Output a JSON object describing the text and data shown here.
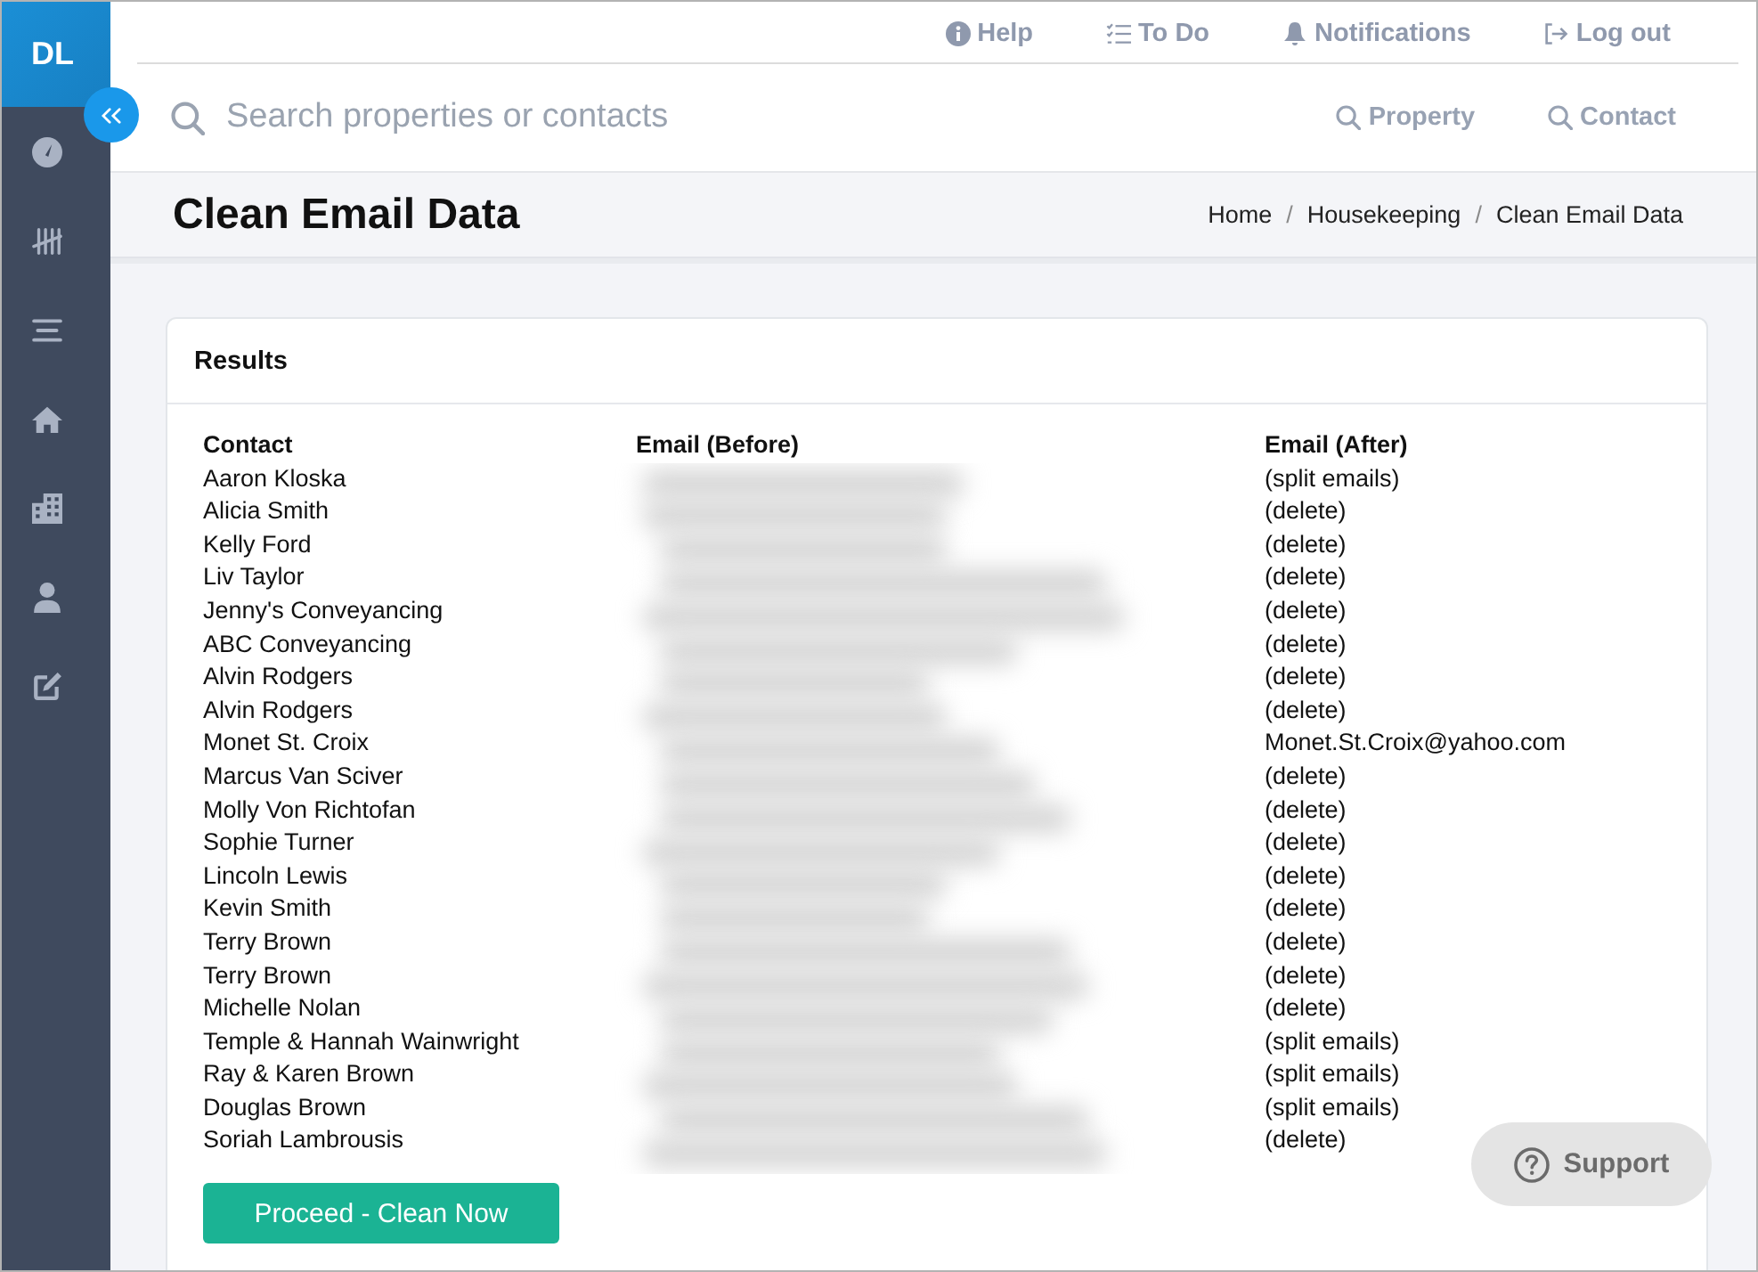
{
  "sidebar": {
    "logo": "DL"
  },
  "top_links": [
    {
      "label": "Help"
    },
    {
      "label": "To Do"
    },
    {
      "label": "Notifications"
    },
    {
      "label": "Log out"
    }
  ],
  "search": {
    "placeholder": "Search properties or contacts",
    "scopes": [
      {
        "label": "Property"
      },
      {
        "label": "Contact"
      }
    ]
  },
  "page_header": {
    "title": "Clean Email Data",
    "breadcrumb": [
      {
        "label": "Home"
      },
      {
        "separator": "/",
        "label": "Housekeeping"
      },
      {
        "separator": "/",
        "label": "Clean Email Data"
      }
    ]
  },
  "card": {
    "title": "Results",
    "table": {
      "columns": [
        "Contact",
        "Email (Before)",
        "Email (After)"
      ],
      "rows": [
        {
          "contact": "Aaron Kloska",
          "email_after": "(split emails)"
        },
        {
          "contact": "Alicia Smith",
          "email_after": "(delete)"
        },
        {
          "contact": "Kelly Ford",
          "email_after": "(delete)"
        },
        {
          "contact": "Liv Taylor",
          "email_after": "(delete)"
        },
        {
          "contact": "Jenny's Conveyancing",
          "email_after": "(delete)"
        },
        {
          "contact": "ABC Conveyancing",
          "email_after": "(delete)"
        },
        {
          "contact": "Alvin Rodgers",
          "email_after": "(delete)"
        },
        {
          "contact": "Alvin Rodgers",
          "email_after": "(delete)"
        },
        {
          "contact": "Monet St. Croix",
          "email_after": "Monet.St.Croix@yahoo.com"
        },
        {
          "contact": "Marcus Van Sciver",
          "email_after": "(delete)"
        },
        {
          "contact": "Molly Von Richtofan",
          "email_after": "(delete)"
        },
        {
          "contact": "Sophie Turner",
          "email_after": "(delete)"
        },
        {
          "contact": "Lincoln Lewis",
          "email_after": "(delete)"
        },
        {
          "contact": "Kevin Smith",
          "email_after": "(delete)"
        },
        {
          "contact": "Terry Brown",
          "email_after": "(delete)"
        },
        {
          "contact": "Terry Brown",
          "email_after": "(delete)"
        },
        {
          "contact": "Michelle Nolan",
          "email_after": "(delete)"
        },
        {
          "contact": "Temple & Hannah Wainwright",
          "email_after": "(split emails)"
        },
        {
          "contact": "Ray & Karen Brown",
          "email_after": "(split emails)"
        },
        {
          "contact": "Douglas Brown",
          "email_after": "(split emails)"
        },
        {
          "contact": "Soriah Lambrousis",
          "email_after": "(delete)"
        }
      ]
    },
    "button": "Proceed - Clean Now"
  },
  "support_button": "Support"
}
